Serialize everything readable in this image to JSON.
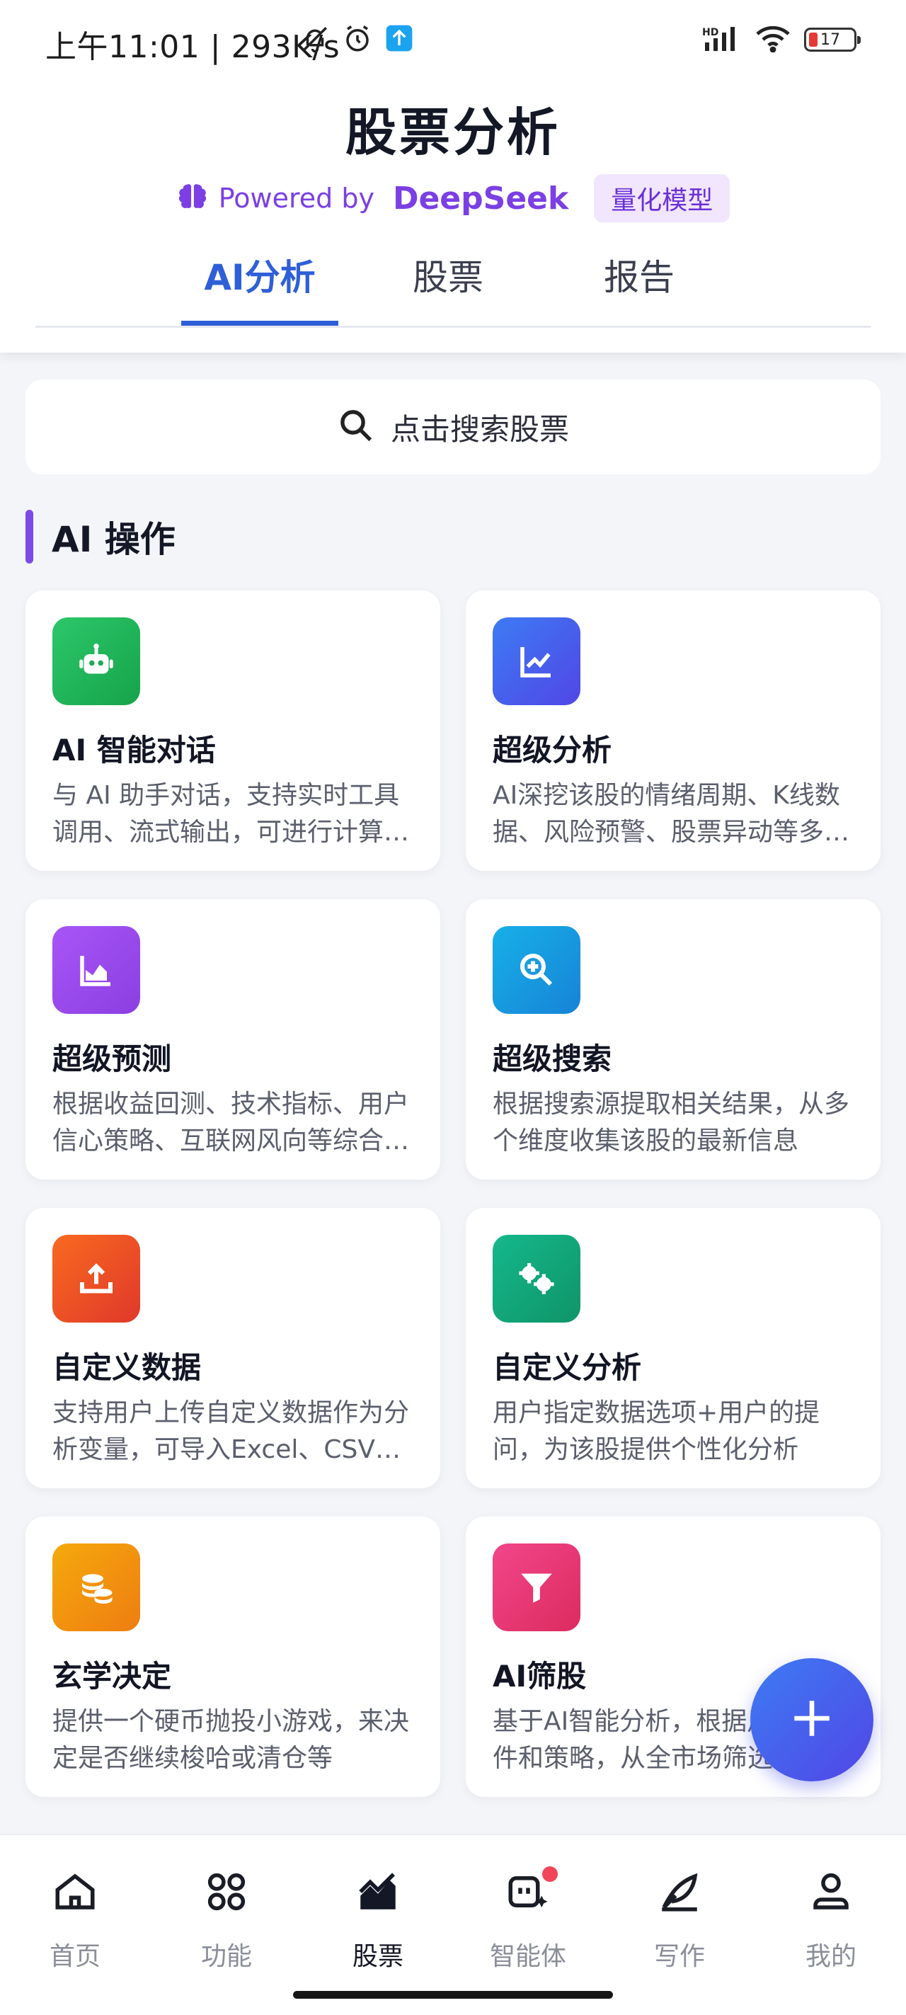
{
  "status_bar": {
    "time": "上午11:01 | 293K/s",
    "battery": "17"
  },
  "header": {
    "title": "股票分析",
    "powered_by": "Powered by",
    "brand": "DeepSeek",
    "badge": "量化模型"
  },
  "tabs": [
    {
      "label": "AI分析",
      "active": true
    },
    {
      "label": "股票",
      "active": false
    },
    {
      "label": "报告",
      "active": false
    }
  ],
  "search": {
    "placeholder": "点击搜索股票"
  },
  "section": {
    "title": "AI 操作"
  },
  "cards": [
    {
      "title": "AI 智能对话",
      "desc": "与 AI 助手对话，支持实时工具调用、流式输出，可进行计算与分析",
      "icon": "robot-icon",
      "color": "#22b35e"
    },
    {
      "title": "超级分析",
      "desc": "AI深挖该股的情绪周期、K线数据、风险预警、股票异动等多维度信息",
      "icon": "line-chart-icon",
      "color": "#4a6ff0"
    },
    {
      "title": "超级预测",
      "desc": "根据收益回测、技术指标、用户信心策略、互联网风向等综合预测",
      "icon": "area-chart-icon",
      "color": "#9a4de8"
    },
    {
      "title": "超级搜索",
      "desc": "根据搜索源提取相关结果，从多个维度收集该股的最新信息",
      "icon": "search-plus-icon",
      "color": "#1b9ede"
    },
    {
      "title": "自定义数据",
      "desc": "支持用户上传自定义数据作为分析变量，可导入Excel、CSV等格式",
      "icon": "upload-icon",
      "color": "#ee4d2c"
    },
    {
      "title": "自定义分析",
      "desc": "用户指定数据选项+用户的提问，为该股提供个性化分析",
      "icon": "gears-icon",
      "color": "#12a37a"
    },
    {
      "title": "玄学决定",
      "desc": "提供一个硬币抛投小游戏，来决定是否继续梭哈或清仓等",
      "icon": "coins-icon",
      "color": "#f0940f"
    },
    {
      "title": "AI筛股",
      "desc": "基于AI智能分析，根据用户的条件和策略，从全市场筛选股票",
      "icon": "filter-icon",
      "color": "#ec3a7c"
    }
  ],
  "bottom_nav": [
    {
      "label": "首页",
      "icon": "home-icon",
      "active": false
    },
    {
      "label": "功能",
      "icon": "grid-icon",
      "active": false
    },
    {
      "label": "股票",
      "icon": "stock-chart-icon",
      "active": true
    },
    {
      "label": "智能体",
      "icon": "agent-icon",
      "active": false
    },
    {
      "label": "写作",
      "icon": "quill-icon",
      "active": false
    },
    {
      "label": "我的",
      "icon": "user-icon",
      "active": false
    }
  ]
}
